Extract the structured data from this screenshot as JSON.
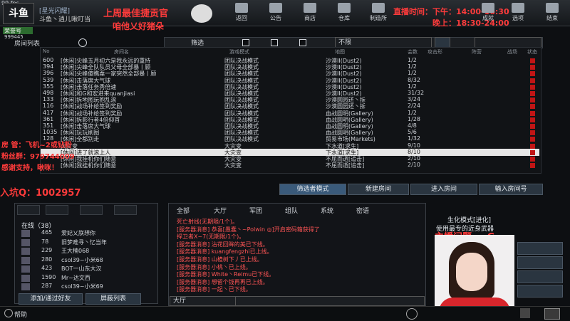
{
  "window": {
    "fps": "99 fps",
    "logo": "斗鱼",
    "room_title": "[星光闪耀]",
    "room_sub": "斗鱼丶逍儿啾叮当",
    "vip": "荣誉号",
    "player_id": "999445"
  },
  "overlays": {
    "banner": "上周最佳捷贡官",
    "banner_sub": "咱他乂好猪朵",
    "live_time": "直播时间：下午：14:00-16:30",
    "live_time2": "晚上：18:30-24:00",
    "admin": "房  管：飞机~2或钻粉",
    "fans": "粉丝群：979744009",
    "thanks": "感谢支持，啾咪！",
    "qq": "入坑Q：1002957",
    "host_note": "主播问题~~G"
  },
  "nav": [
    {
      "label": "返回",
      "icon": "back-icon"
    },
    {
      "label": "公告",
      "icon": "megaphone-icon"
    },
    {
      "label": "商店",
      "icon": "shop-icon"
    },
    {
      "label": "仓库",
      "icon": "warehouse-icon"
    },
    {
      "label": "制造所",
      "icon": "manufacture-icon"
    },
    {
      "label": "成就",
      "icon": "trophy-icon"
    },
    {
      "label": "选项",
      "icon": "options-icon"
    },
    {
      "label": "结束",
      "icon": "power-icon"
    }
  ],
  "room_list": {
    "title": "房间列表",
    "filter_label": "筛选",
    "ddl": "不限",
    "headers": [
      "No",
      "房间名",
      "游戏模式",
      "地图",
      "会数",
      "攻击形",
      "阵营",
      "战场",
      "状态"
    ],
    "rows": [
      {
        "no": "600",
        "name": "[休闲]尖峰五月初六是我永远的重持",
        "mode": "团队决战模式",
        "map": "沙漠II(Dust2)",
        "count": "1/2"
      },
      {
        "no": "394",
        "name": "[休闲]尖峰全队队员父母全部暴丨顾",
        "mode": "团队决战模式",
        "map": "沙漠II(Dust2)",
        "count": "1/2"
      },
      {
        "no": "396",
        "name": "[休闲]尖峰傻瞧粟一家突然全部暴丨顾",
        "mode": "团队决战模式",
        "map": "沙漠II(Dust2)",
        "count": "1/2"
      },
      {
        "no": "539",
        "name": "[休闲]击落席大气球",
        "mode": "团队决战模式",
        "map": "沙漠II(Dust2)",
        "count": "8/32"
      },
      {
        "no": "355",
        "name": "[休闲]击落任务秀倍速",
        "mode": "团队决战模式",
        "map": "沙漠II(Dust2)",
        "count": "1/2"
      },
      {
        "no": "498",
        "name": "[休闲]和G和宏进来quanjiasi",
        "mode": "团队决战模式",
        "map": "沙漠II(Dust2)",
        "count": "31/32"
      },
      {
        "no": "133",
        "name": "[休闲]拆地图玩抱乱滚",
        "mode": "团队决战模式",
        "map": "沙漠圆园还丶拆",
        "count": "3/24"
      },
      {
        "no": "116",
        "name": "[休闲]战场补给签到奖励",
        "mode": "团队决战模式",
        "map": "沙漠圆园还丶拆",
        "count": "2/24"
      },
      {
        "no": "417",
        "name": "[休闲]战场补给签到奖励",
        "mode": "团队决战模式",
        "map": "血战圆明(Gallery)",
        "count": "1/2"
      },
      {
        "no": "361",
        "name": "[休闲]拆影行者4倍仰首",
        "mode": "团队决战模式",
        "map": "血战圆明(Gallery)",
        "count": "1/28"
      },
      {
        "no": "351",
        "name": "[休闲]击落席大气球",
        "mode": "团队决战模式",
        "map": "血战圆明(Gallery)",
        "count": "4/8"
      },
      {
        "no": "1035",
        "name": "[休闲]玩玩刷图",
        "mode": "团队决战模式",
        "map": "血战圆明(Gallery)",
        "count": "5/6"
      },
      {
        "no": "128",
        "name": "[休闲]全都别走",
        "mode": "团队决战模式",
        "map": "贸易市场(Markets)",
        "count": "1/32"
      },
      {
        "no": "",
        "name": "大灾变",
        "mode": "大灾变",
        "map": "下水道[求生]",
        "count": "9/10"
      },
      {
        "no": "",
        "name": "[休闲]进了就滚上人",
        "mode": "大灾变",
        "map": "下水道[求生]",
        "count": "8/10"
      },
      {
        "no": "",
        "name": "[休闲]我挂机你们随意",
        "mode": "大灾变",
        "map": "不屈而逝[追击]",
        "count": "2/10"
      },
      {
        "no": "",
        "name": "[休闲]我挂机你们随意",
        "mode": "大灾变",
        "map": "不屈而逝[追击]",
        "count": "2/10"
      }
    ]
  },
  "buttons": {
    "filter_mode": "筛选者模式",
    "new_room": "新建房间",
    "enter_room": "进入房间",
    "enter_number": "输入房间号"
  },
  "friends": {
    "online_label": "在线（38）",
    "rows": [
      {
        "lv": "465",
        "name": "爱妃乂朕想你"
      },
      {
        "lv": "78",
        "name": "旧梦难寻丶忆当年"
      },
      {
        "lv": "229",
        "name": "王大楠068"
      },
      {
        "lv": "280",
        "name": "csol39~小米68"
      },
      {
        "lv": "423",
        "name": "BOT一山东大汉"
      },
      {
        "lv": "1590",
        "name": "Mr~达文西"
      },
      {
        "lv": "287",
        "name": "csol39~小米69"
      }
    ],
    "add_btn": "添加/通过好友",
    "block_btn": "屏蔽列表"
  },
  "chat": {
    "tabs": [
      "全部",
      "大厅",
      "军团",
      "组队",
      "系统",
      "密语"
    ],
    "lines": [
      {
        "text": "死亡射线(无期限/1个)。",
        "color": "#ff5555"
      },
      {
        "text": "[服务器消息] 恭喜[愚蠢丶~Polwin ◎]开启密码箱获得了",
        "color": "#ff5555"
      },
      {
        "text": "捍卫者X~7(无期限/1个)。",
        "color": "#ff5555"
      },
      {
        "text": "[服务器消息] 沾花回眸的美已下线。",
        "color": "#ff5555"
      },
      {
        "text": "[服务器消息] kuangfengzhi已上线。",
        "color": "#ff5555"
      },
      {
        "text": "[服务器消息] 山楂树下丿已上线。",
        "color": "#ff5555"
      },
      {
        "text": "[服务器消息] 小桃丶已上线。",
        "color": "#ff5555"
      },
      {
        "text": "[服务器消息] White丶Reimu已下线。",
        "color": "#ff5555"
      },
      {
        "text": "[服务器消息] 想留个钱再再已上线。",
        "color": "#ff5555"
      },
      {
        "text": "[服务器消息] 一起丶已下线。",
        "color": "#ff5555"
      }
    ],
    "channel": "大厅"
  },
  "right_panel": {
    "title": "生化模式[进化]",
    "desc": "使用最专的近身武器"
  },
  "footer": {
    "help": "帮助"
  }
}
